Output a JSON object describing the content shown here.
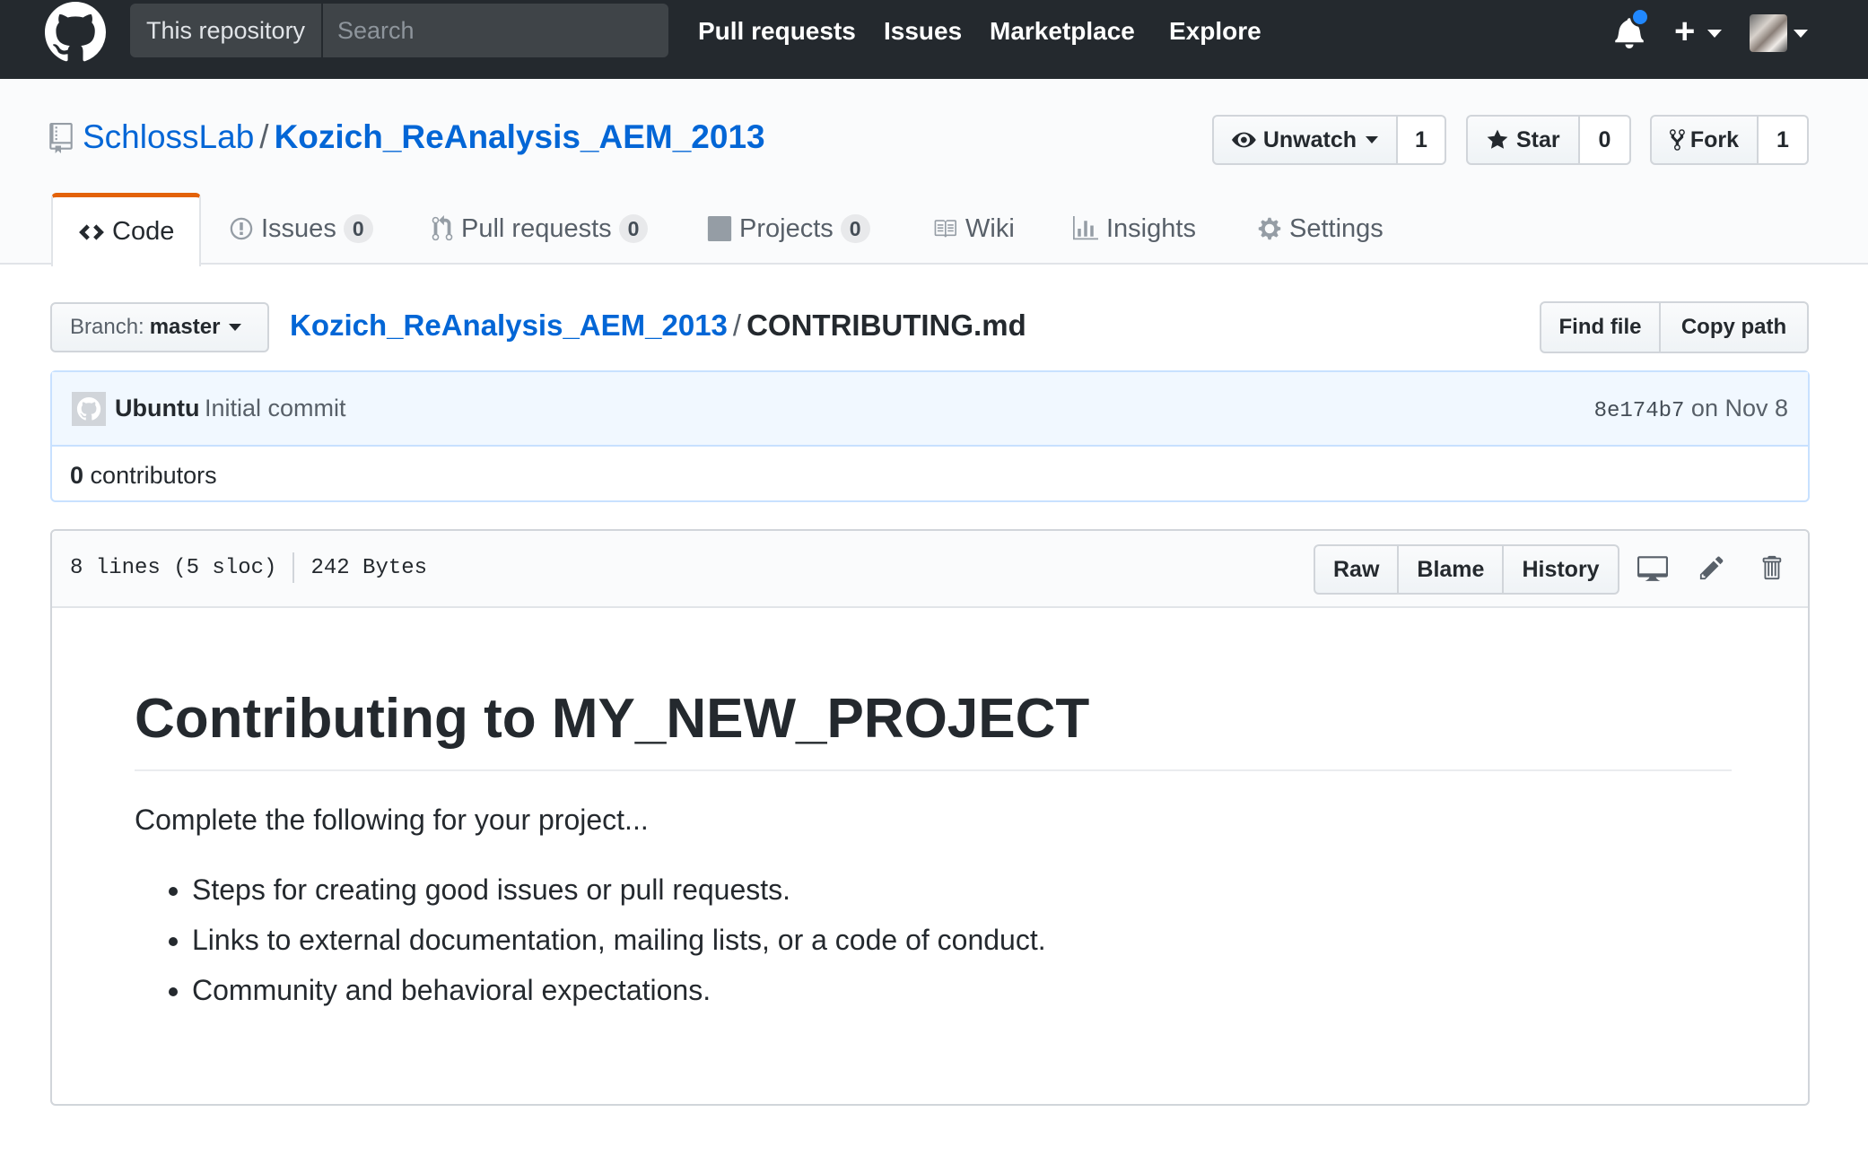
{
  "header": {
    "search_scope": "This repository",
    "search_placeholder": "Search",
    "nav": [
      "Pull requests",
      "Issues",
      "Marketplace",
      "Explore"
    ]
  },
  "repo": {
    "owner": "SchlossLab",
    "name": "Kozich_ReAnalysis_AEM_2013",
    "watch_label": "Unwatch",
    "watch_count": "1",
    "star_label": "Star",
    "star_count": "0",
    "fork_label": "Fork",
    "fork_count": "1"
  },
  "tabs": [
    {
      "label": "Code",
      "icon": "code-icon"
    },
    {
      "label": "Issues",
      "count": "0",
      "icon": "issue-opened-icon"
    },
    {
      "label": "Pull requests",
      "count": "0",
      "icon": "git-pull-request-icon"
    },
    {
      "label": "Projects",
      "count": "0",
      "icon": "project-icon"
    },
    {
      "label": "Wiki",
      "icon": "book-icon"
    },
    {
      "label": "Insights",
      "icon": "graph-icon"
    },
    {
      "label": "Settings",
      "icon": "gear-icon"
    }
  ],
  "filenav": {
    "branch_prefix": "Branch:",
    "branch_name": "master",
    "path_repo": "Kozich_ReAnalysis_AEM_2013",
    "path_file": "CONTRIBUTING.md",
    "find_file": "Find file",
    "copy_path": "Copy path"
  },
  "commit": {
    "author": "Ubuntu",
    "message": "Initial commit",
    "sha": "8e174b7",
    "date": "on Nov 8",
    "contributors_count": "0",
    "contributors_label": "contributors"
  },
  "file": {
    "lines": "8 lines (5 sloc)",
    "size": "242 Bytes",
    "actions": [
      "Raw",
      "Blame",
      "History"
    ]
  },
  "content": {
    "heading": "Contributing to MY_NEW_PROJECT",
    "intro": "Complete the following for your project...",
    "bullets": [
      "Steps for creating good issues or pull requests.",
      "Links to external documentation, mailing lists, or a code of conduct.",
      "Community and behavioral expectations."
    ]
  },
  "colors": {
    "header_bg": "#24292e",
    "link": "#0366d6",
    "selected_tab_accent": "#e36209",
    "notification_dot": "#2188ff"
  }
}
